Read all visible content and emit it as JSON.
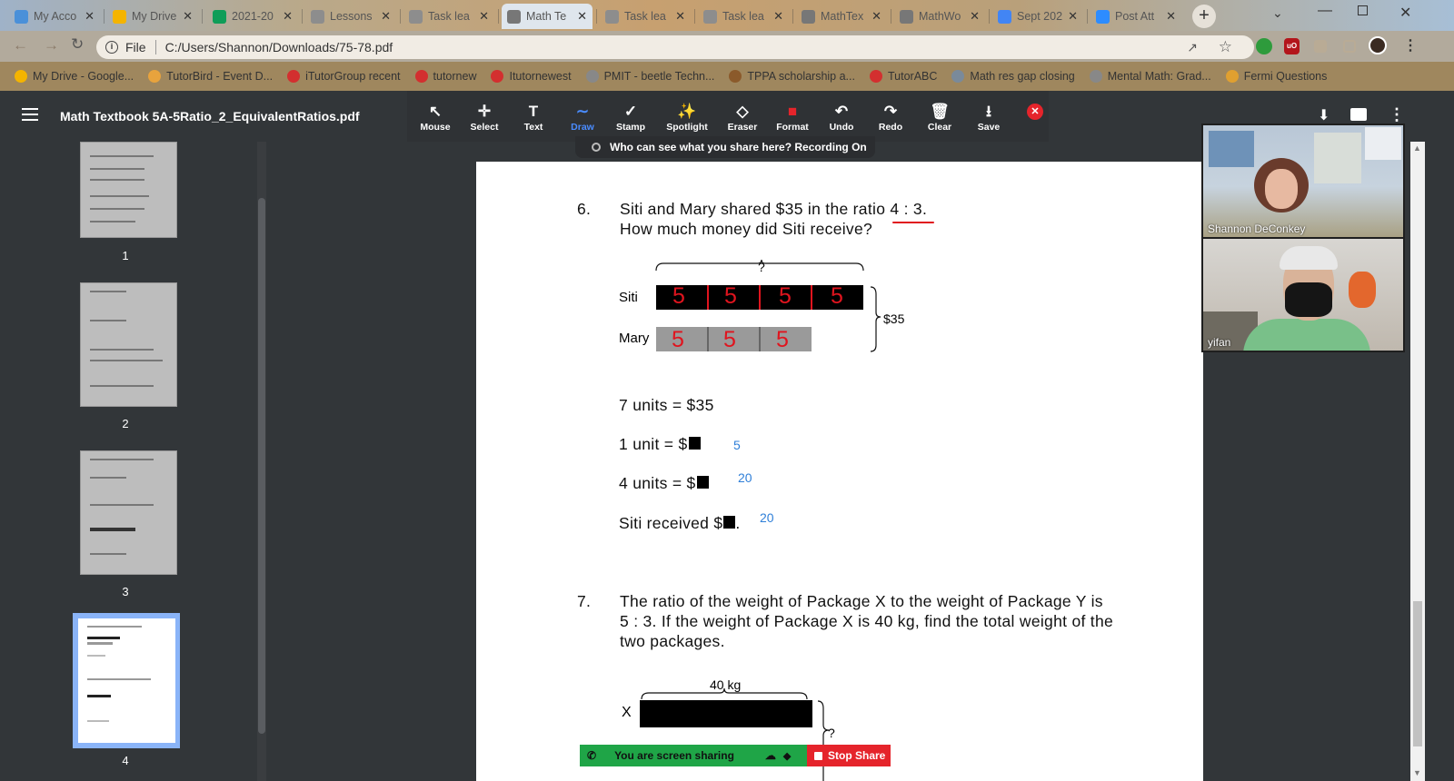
{
  "browser": {
    "tabs": [
      {
        "label": "My Acco",
        "favicon": "account-icon",
        "color": "#4a90d9"
      },
      {
        "label": "My Drive",
        "favicon": "drive-icon",
        "color": "#f4b400"
      },
      {
        "label": "2021-20",
        "favicon": "sheets-icon",
        "color": "#0f9d58"
      },
      {
        "label": "Lessons",
        "favicon": "doc-icon",
        "color": "#8d8d8d"
      },
      {
        "label": "Task lea",
        "favicon": "doc-icon",
        "color": "#8d8d8d"
      },
      {
        "label": "Math Te",
        "favicon": "globe-icon",
        "color": "#777777"
      },
      {
        "label": "Task lea",
        "favicon": "doc-icon",
        "color": "#8d8d8d"
      },
      {
        "label": "Task lea",
        "favicon": "doc-icon",
        "color": "#8d8d8d"
      },
      {
        "label": "MathTex",
        "favicon": "globe-icon",
        "color": "#777777"
      },
      {
        "label": "MathWo",
        "favicon": "globe-icon",
        "color": "#777777"
      },
      {
        "label": "Sept 202",
        "favicon": "docs-icon",
        "color": "#4285f4"
      },
      {
        "label": "Post Att",
        "favicon": "zoom-icon",
        "color": "#2d8cff"
      }
    ],
    "active_tab_index": 5,
    "address": {
      "scheme_label": "File",
      "url": "C:/Users/Shannon/Downloads/75-78.pdf"
    },
    "bookmarks": [
      {
        "label": "My Drive - Google...",
        "color": "#f4b400"
      },
      {
        "label": "TutorBird - Event D...",
        "color": "#e8a33d"
      },
      {
        "label": "iTutorGroup recent",
        "color": "#d32f2f"
      },
      {
        "label": "tutornew",
        "color": "#d32f2f"
      },
      {
        "label": "Itutornewest",
        "color": "#d32f2f"
      },
      {
        "label": "PMIT - beetle Techn...",
        "color": "#888888"
      },
      {
        "label": "TPPA scholarship a...",
        "color": "#8b5a2b"
      },
      {
        "label": "TutorABC",
        "color": "#d32f2f"
      },
      {
        "label": "Math res gap closing",
        "color": "#7a8a9a"
      },
      {
        "label": "Mental Math: Grad...",
        "color": "#888888"
      },
      {
        "label": "Fermi Questions",
        "color": "#e0a030"
      }
    ]
  },
  "viewer": {
    "title": "Math Textbook 5A-5Ratio_2_EquivalentRatios.pdf",
    "tools": [
      "Mouse",
      "Select",
      "Text",
      "Draw",
      "Stamp",
      "Spotlight",
      "Eraser",
      "Format",
      "Undo",
      "Redo",
      "Clear",
      "Save"
    ],
    "active_tool": "Draw",
    "notice": "Who can see what you share here? Recording On",
    "pages": [
      "1",
      "2",
      "3",
      "4"
    ],
    "selected_page": "4"
  },
  "document": {
    "q6": {
      "number": "6.",
      "line1": "Siti and Mary shared $35 in the ratio 4 : 3.",
      "line2": "How much money did Siti receive?",
      "bar_top_label": "?",
      "siti_label": "Siti",
      "mary_label": "Mary",
      "total_label": "$35",
      "siti_units": [
        "5",
        "5",
        "5",
        "5"
      ],
      "mary_units": [
        "5",
        "5",
        "5"
      ],
      "step1": "7 units = $35",
      "step2": "1 unit = $",
      "step3": "4 units = $",
      "step4_a": "Siti received $",
      "step4_b": ".",
      "answers": [
        "5",
        "20",
        "20"
      ]
    },
    "q7": {
      "number": "7.",
      "line1": "The ratio of the weight of Package X to the weight of Package Y is",
      "line2": "5 : 3. If the weight of Package X is 40 kg, find the total weight of the",
      "line3": "two packages.",
      "bar_top_label": "40 kg",
      "x_label": "X",
      "right_label": "?"
    }
  },
  "video": {
    "participants": [
      {
        "name": "Shannon DeConkey"
      },
      {
        "name": "yifan"
      }
    ]
  },
  "share": {
    "status": "You are screen sharing",
    "stop_label": "Stop Share"
  },
  "colors": {
    "ink_red": "#e0141e",
    "ink_blue": "#2f7fd8",
    "stop_red": "#e5242b",
    "share_green": "#1fa547"
  }
}
